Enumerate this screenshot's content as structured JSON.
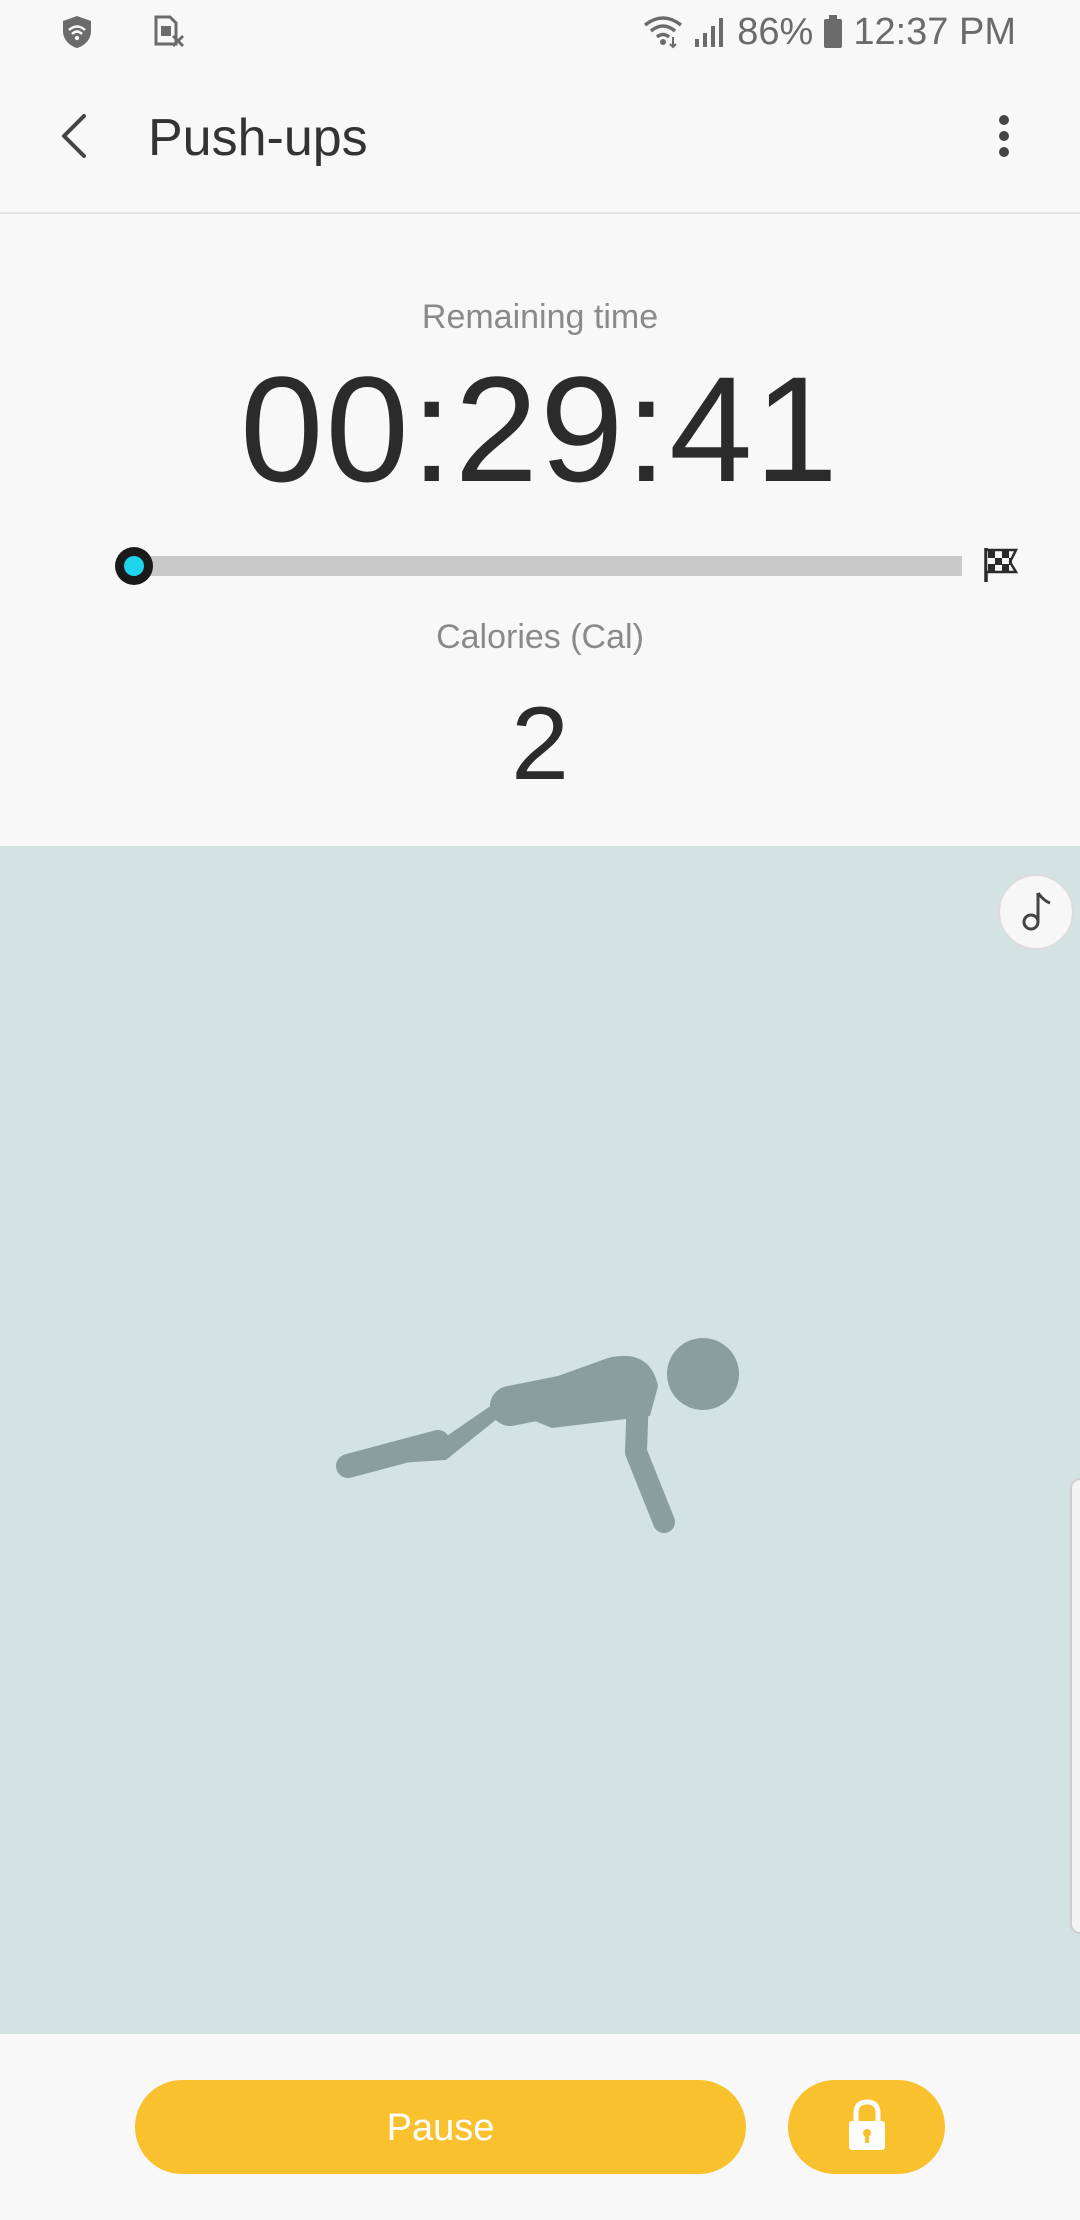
{
  "status_bar": {
    "battery": "86%",
    "time": "12:37 PM",
    "icons": [
      "shield-icon",
      "sim-card-icon",
      "wifi-icon",
      "signal-icon",
      "battery-icon"
    ]
  },
  "app_bar": {
    "title": "Push-ups",
    "icons": [
      "back-arrow-icon",
      "more-vert-icon"
    ]
  },
  "workout": {
    "remaining_label": "Remaining time",
    "remaining_time": "00:29:41",
    "progress_fraction": 0.01,
    "calories_label": "Calories (Cal)",
    "calories_value": "2",
    "icons": [
      "checkered-flag-icon"
    ]
  },
  "animation": {
    "icons": [
      "music-note-icon",
      "pushup-figure"
    ]
  },
  "controls": {
    "pause_label": "Pause",
    "icons": [
      "lock-icon"
    ]
  },
  "colors": {
    "accent_yellow": "#F9C12D",
    "progress_cyan": "#1ED3EC",
    "panel_background": "#D3E3E2",
    "figure_gray": "#8A9E9D"
  }
}
